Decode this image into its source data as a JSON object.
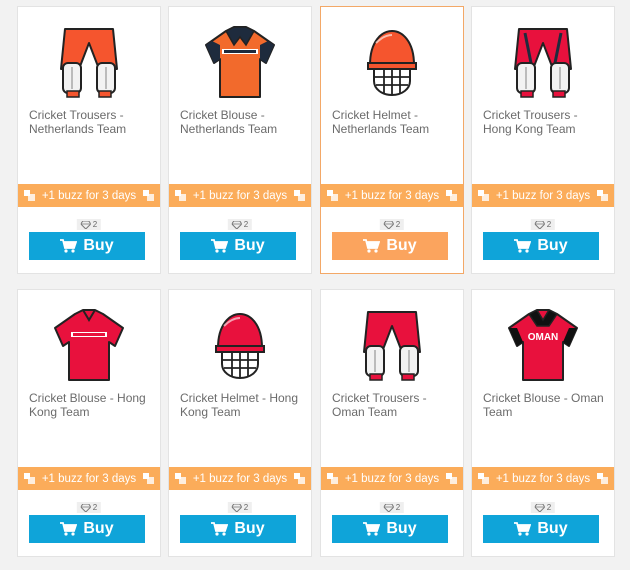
{
  "colors": {
    "buzz_bar": "#fbac5a",
    "buy_button": "#0fa4d9",
    "buy_button_selected": "#fba45e",
    "selected_border": "#f3a867"
  },
  "items": [
    {
      "name": "Cricket Trousers - Netherlands Team",
      "icon": "trousers-icon",
      "buzz": "+1 buzz for 3 days",
      "price": "2",
      "buy": "Buy"
    },
    {
      "name": "Cricket Blouse - Netherlands Team",
      "icon": "jersey-icon",
      "buzz": "+1 buzz for 3 days",
      "price": "2",
      "buy": "Buy"
    },
    {
      "name": "Cricket Helmet - Netherlands Team",
      "icon": "helmet-icon",
      "buzz": "+1 buzz for 3 days",
      "price": "2",
      "buy": "Buy",
      "selected": true
    },
    {
      "name": "Cricket Trousers - Hong Kong Team",
      "icon": "trousers-icon",
      "buzz": "+1 buzz for 3 days",
      "price": "2",
      "buy": "Buy"
    },
    {
      "name": "Cricket Blouse - Hong Kong Team",
      "icon": "jersey-icon",
      "buzz": "+1 buzz for 3 days",
      "price": "2",
      "buy": "Buy"
    },
    {
      "name": "Cricket Helmet - Hong Kong Team",
      "icon": "helmet-icon",
      "buzz": "+1 buzz for 3 days",
      "price": "2",
      "buy": "Buy"
    },
    {
      "name": "Cricket Trousers - Oman Team",
      "icon": "trousers-icon",
      "buzz": "+1 buzz for 3 days",
      "price": "2",
      "buy": "Buy"
    },
    {
      "name": "Cricket Blouse - Oman Team",
      "icon": "jersey-icon",
      "buzz": "+1 buzz for 3 days",
      "price": "2",
      "buy": "Buy",
      "jersey_text": "OMAN"
    }
  ]
}
